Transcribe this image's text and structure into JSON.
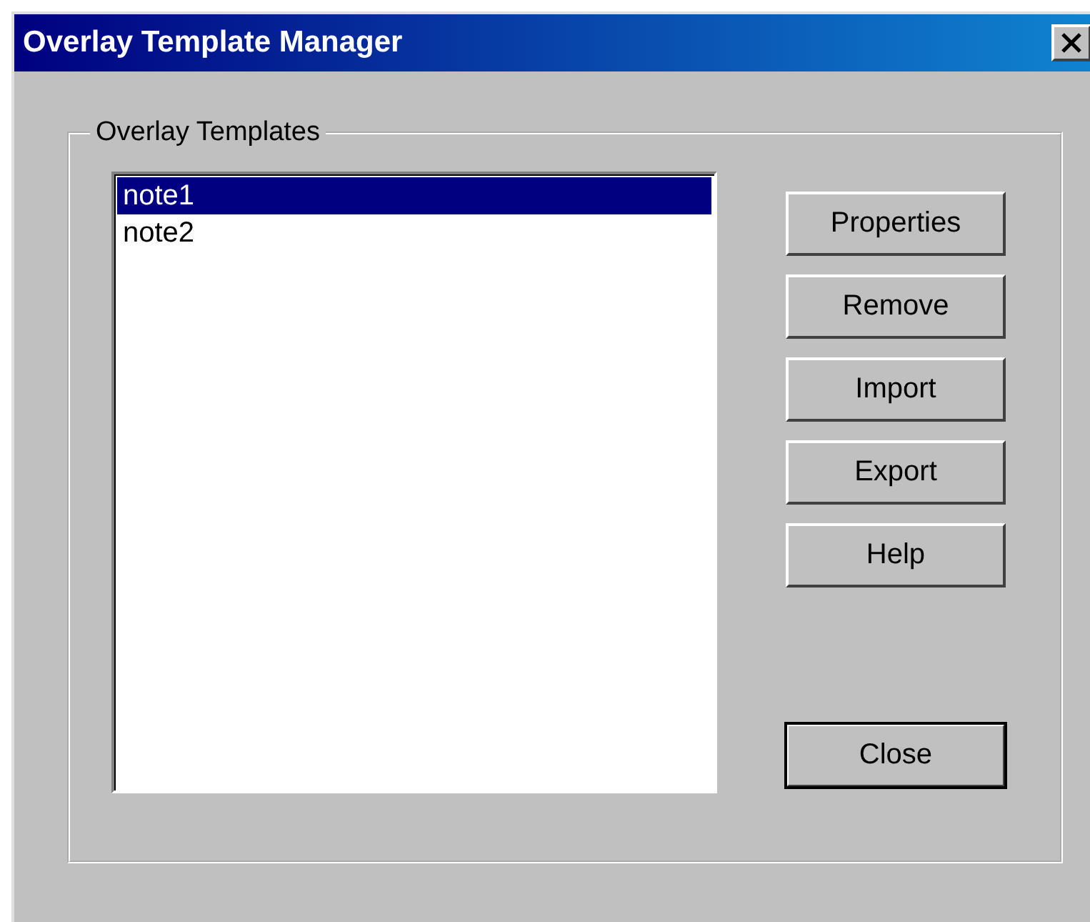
{
  "window": {
    "title": "Overlay Template Manager"
  },
  "group": {
    "label": "Overlay Templates"
  },
  "templates": [
    {
      "name": "note1",
      "selected": true
    },
    {
      "name": "note2",
      "selected": false
    }
  ],
  "buttons": [
    {
      "label": "Properties",
      "default": false
    },
    {
      "label": "Remove",
      "default": false
    },
    {
      "label": "Import",
      "default": false
    },
    {
      "label": "Export",
      "default": false
    },
    {
      "label": "Help",
      "default": false
    },
    {
      "label": "Close",
      "default": true
    }
  ]
}
